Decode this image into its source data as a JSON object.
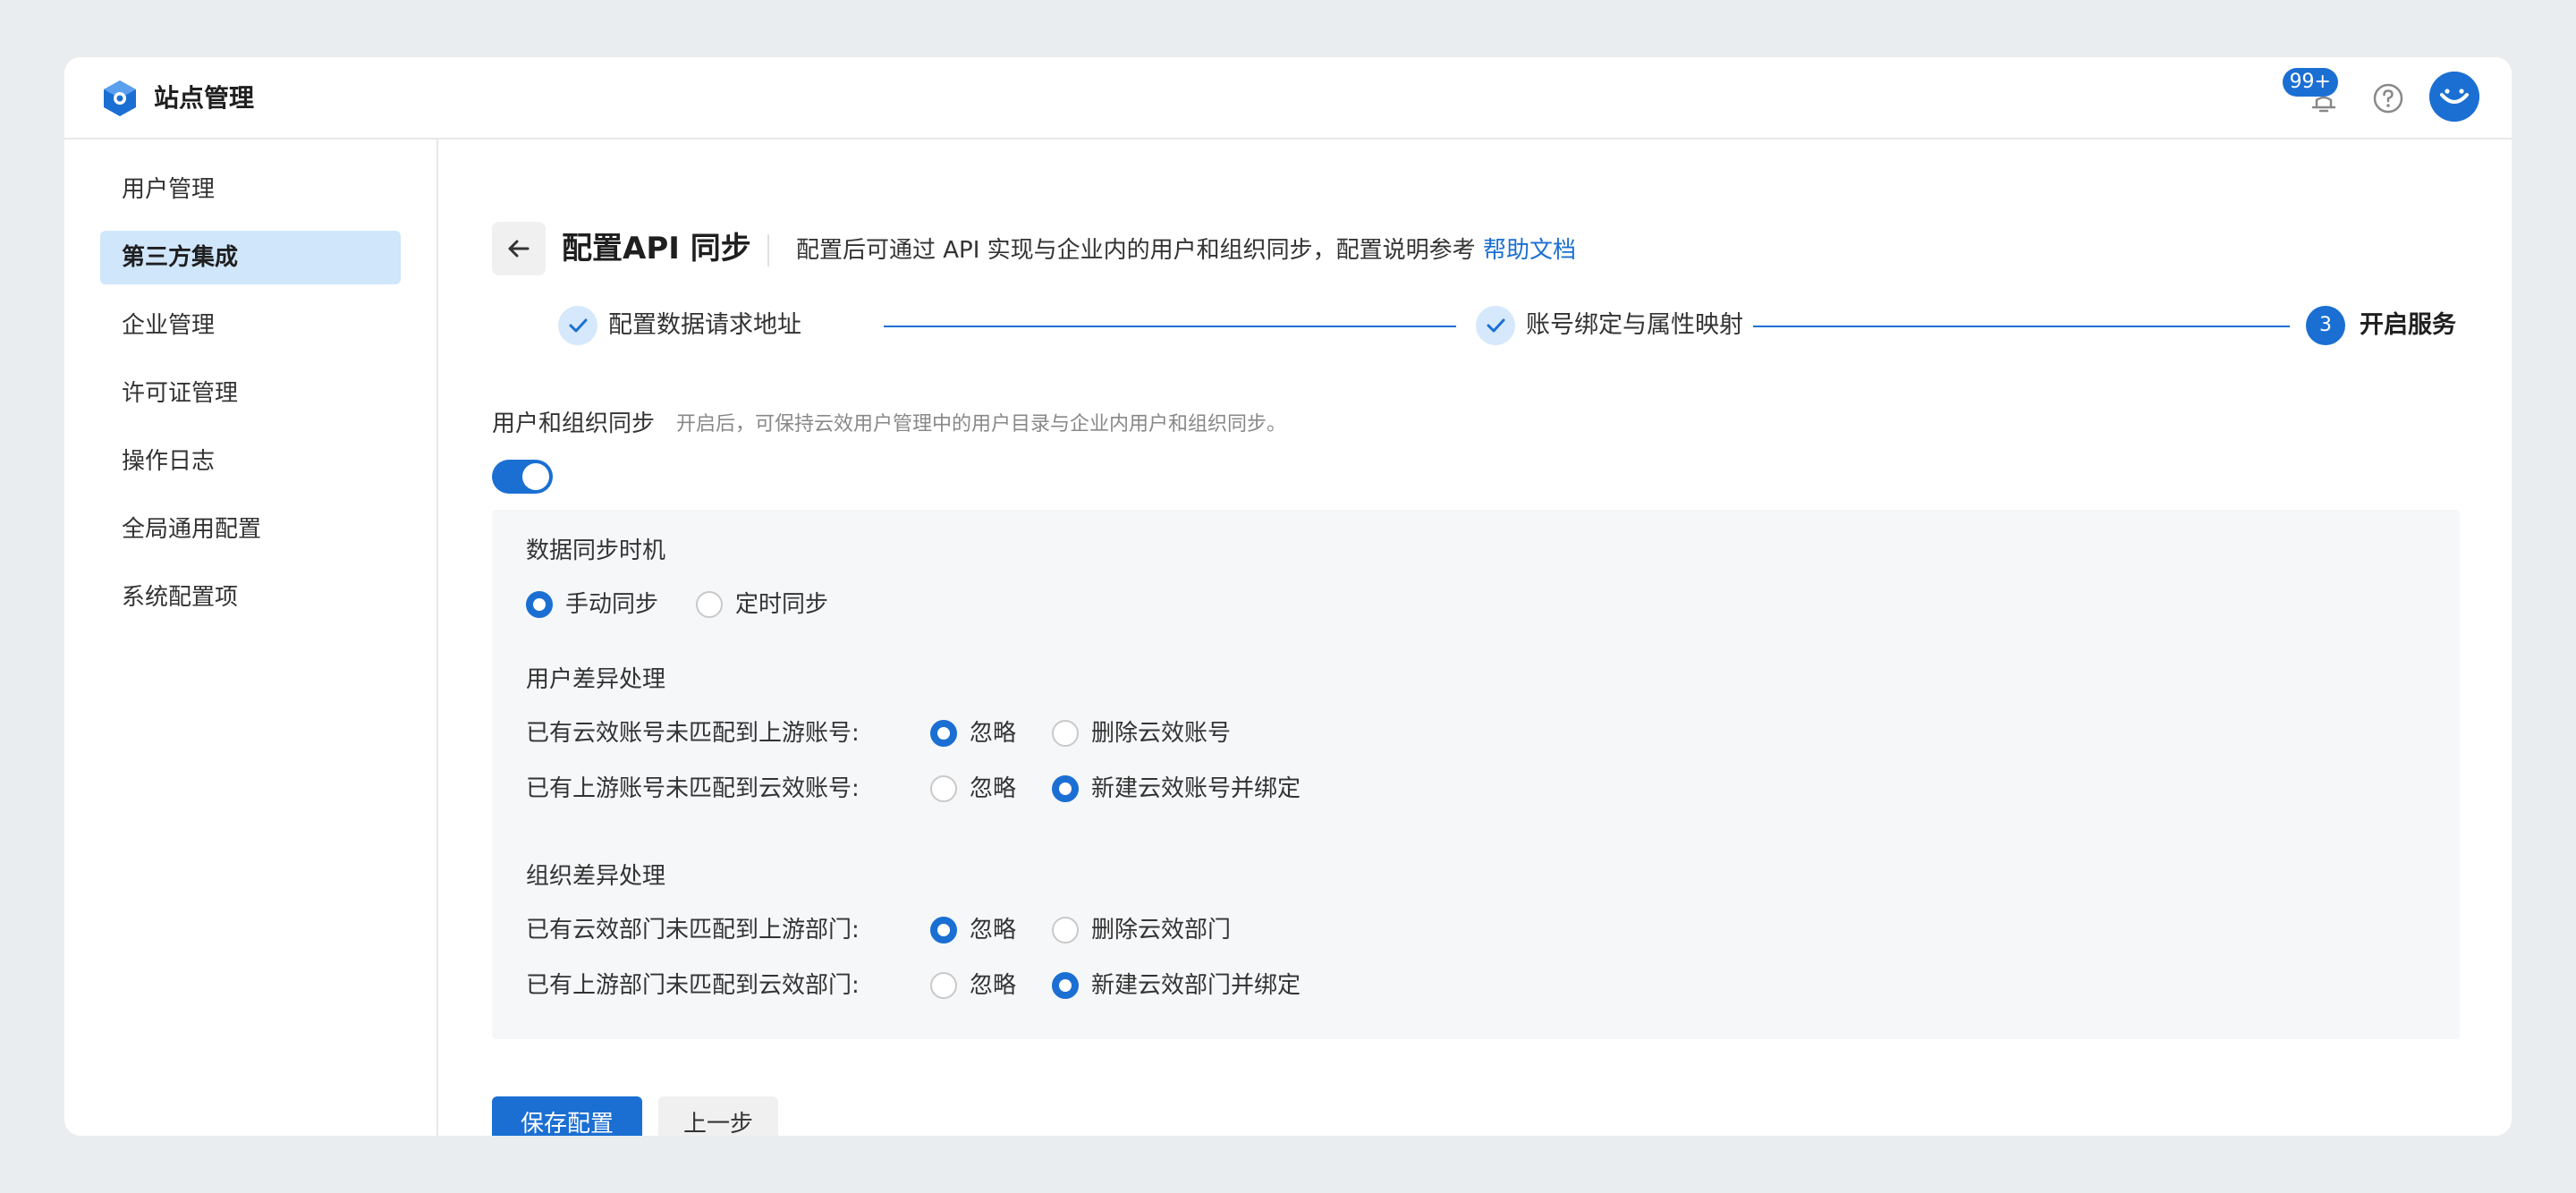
{
  "app": {
    "title": "站点管理",
    "notification_badge": "99+",
    "logo_icon": "cube-logo-icon",
    "accent_color": "#1b6fd3"
  },
  "sidebar": {
    "items": [
      {
        "label": "用户管理",
        "active": false
      },
      {
        "label": "第三方集成",
        "active": true
      },
      {
        "label": "企业管理",
        "active": false
      },
      {
        "label": "许可证管理",
        "active": false
      },
      {
        "label": "操作日志",
        "active": false
      },
      {
        "label": "全局通用配置",
        "active": false
      },
      {
        "label": "系统配置项",
        "active": false
      }
    ]
  },
  "header": {
    "title": "配置API 同步",
    "description": "配置后可通过 API 实现与企业内的用户和组织同步，配置说明参考",
    "help_link": "帮助文档"
  },
  "steps": [
    {
      "label": "配置数据请求地址",
      "status": "done"
    },
    {
      "label": "账号绑定与属性映射",
      "status": "done"
    },
    {
      "label": "开启服务",
      "status": "current",
      "number": "3"
    }
  ],
  "sync": {
    "label": "用户和组织同步",
    "hint": "开启后，可保持云效用户管理中的用户目录与企业内用户和组织同步。",
    "enabled": true
  },
  "timing": {
    "title": "数据同步时机",
    "options": [
      "手动同步",
      "定时同步"
    ],
    "selected": "手动同步"
  },
  "user_diff": {
    "title": "用户差异处理",
    "rows": [
      {
        "label": "已有云效账号未匹配到上游账号:",
        "options": [
          "忽略",
          "删除云效账号"
        ],
        "selected": "忽略"
      },
      {
        "label": "已有上游账号未匹配到云效账号:",
        "options": [
          "忽略",
          "新建云效账号并绑定"
        ],
        "selected": "新建云效账号并绑定"
      }
    ]
  },
  "org_diff": {
    "title": "组织差异处理",
    "rows": [
      {
        "label": "已有云效部门未匹配到上游部门:",
        "options": [
          "忽略",
          "删除云效部门"
        ],
        "selected": "忽略"
      },
      {
        "label": "已有上游部门未匹配到云效部门:",
        "options": [
          "忽略",
          "新建云效部门并绑定"
        ],
        "selected": "新建云效部门并绑定"
      }
    ]
  },
  "actions": {
    "save_label": "保存配置",
    "prev_label": "上一步"
  }
}
